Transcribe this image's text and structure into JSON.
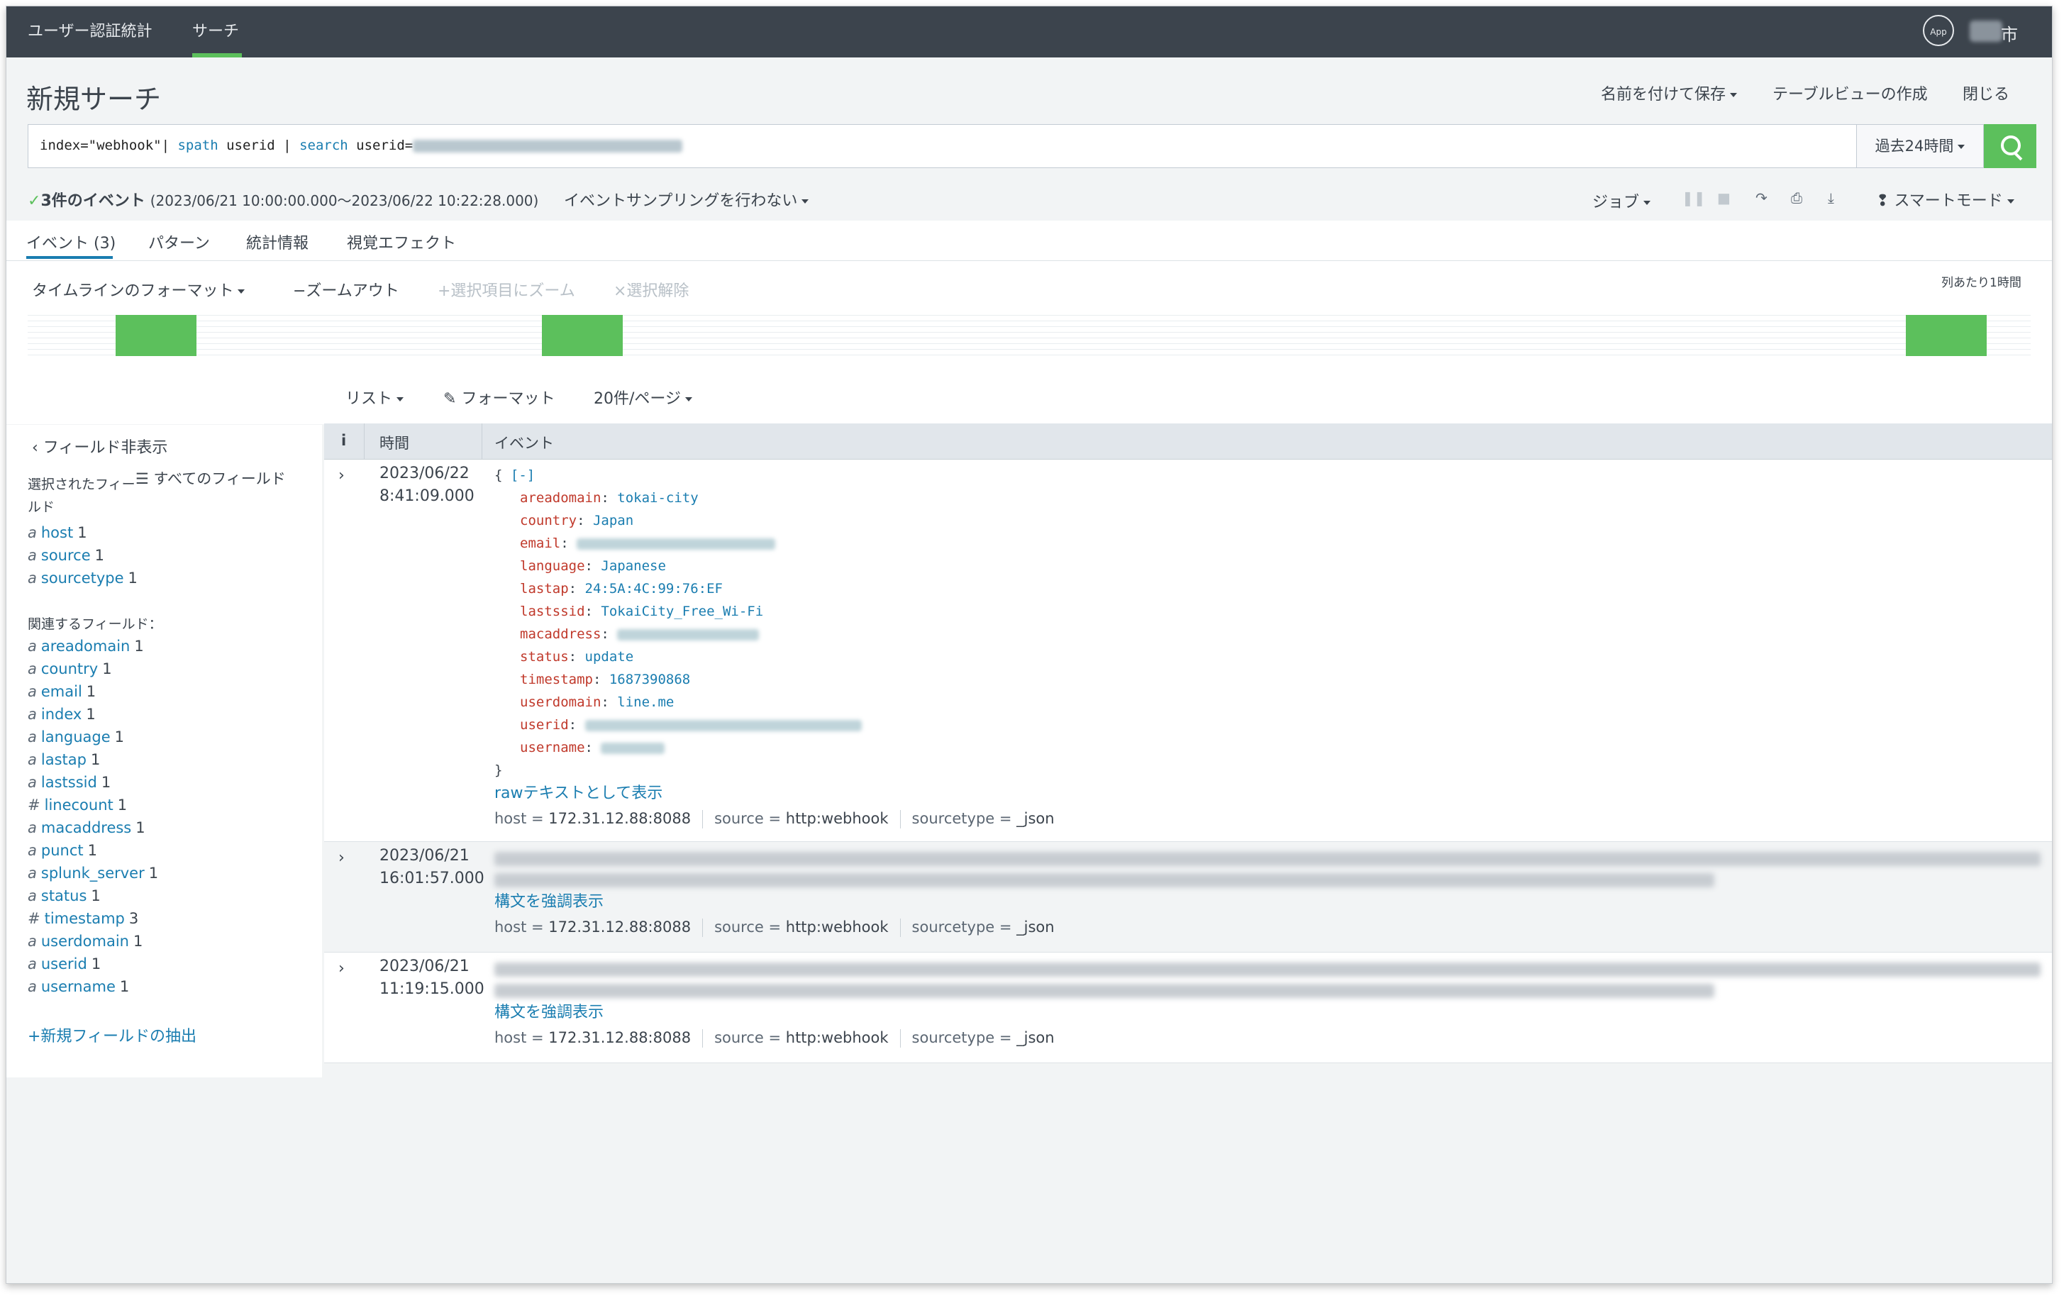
{
  "nav": {
    "app_title": "ユーザー認証統計",
    "search_tab": "サーチ",
    "app_button": "App",
    "user_name_suffix": "市"
  },
  "page": {
    "title": "新規サーチ",
    "save_as": "名前を付けて保存",
    "create_table": "テーブルビューの作成",
    "close": "閉じる"
  },
  "search": {
    "query_p1": "index=\"webhook\"| ",
    "query_kw1": "spath",
    "query_p2": " userid | ",
    "query_kw2": "search",
    "query_p3": " userid=",
    "time_range": "過去24時間"
  },
  "status": {
    "check": "✓",
    "events_count": "3件のイベント",
    "range": "(2023/06/21 10:00:00.000〜2023/06/22 10:22:28.000)",
    "sampling": "イベントサンプリングを行わない",
    "job": "ジョブ",
    "mode": "スマートモード"
  },
  "tabs": {
    "events": "イベント (3)",
    "patterns": "パターン",
    "stats": "統計情報",
    "viz": "視覚エフェクト"
  },
  "timeline": {
    "format": "タイムラインのフォーマット",
    "zoom_out": "−ズームアウト",
    "zoom_sel": "+選択項目にズーム",
    "deselect": "×選択解除",
    "per_col": "列あたり1時間",
    "bars": [
      {
        "hour_index": 2
      },
      {
        "hour_index": 12
      },
      {
        "hour_index": 44
      }
    ]
  },
  "list_controls": {
    "list": "リスト",
    "format": "フォーマット",
    "per_page": "20件/ページ"
  },
  "sidebar": {
    "hide_fields": "フィールド非表示",
    "all_fields": "すべてのフィールド",
    "selected_label": "選択されたフィールド",
    "selected": [
      {
        "type": "a",
        "name": "host",
        "count": "1"
      },
      {
        "type": "a",
        "name": "source",
        "count": "1"
      },
      {
        "type": "a",
        "name": "sourcetype",
        "count": "1"
      }
    ],
    "related_label": "関連するフィールド：",
    "related": [
      {
        "type": "a",
        "name": "areadomain",
        "count": "1"
      },
      {
        "type": "a",
        "name": "country",
        "count": "1"
      },
      {
        "type": "a",
        "name": "email",
        "count": "1"
      },
      {
        "type": "a",
        "name": "index",
        "count": "1"
      },
      {
        "type": "a",
        "name": "language",
        "count": "1"
      },
      {
        "type": "a",
        "name": "lastap",
        "count": "1"
      },
      {
        "type": "a",
        "name": "lastssid",
        "count": "1"
      },
      {
        "type": "#",
        "name": "linecount",
        "count": "1"
      },
      {
        "type": "a",
        "name": "macaddress",
        "count": "1"
      },
      {
        "type": "a",
        "name": "punct",
        "count": "1"
      },
      {
        "type": "a",
        "name": "splunk_server",
        "count": "1"
      },
      {
        "type": "a",
        "name": "status",
        "count": "1"
      },
      {
        "type": "#",
        "name": "timestamp",
        "count": "3"
      },
      {
        "type": "a",
        "name": "userdomain",
        "count": "1"
      },
      {
        "type": "a",
        "name": "userid",
        "count": "1"
      },
      {
        "type": "a",
        "name": "username",
        "count": "1"
      }
    ],
    "extract": "+新規フィールドの抽出"
  },
  "table": {
    "col_info": "i",
    "col_time": "時間",
    "col_event": "イベント"
  },
  "events": [
    {
      "date": "2023/06/22",
      "time": "8:41:09.000",
      "open": "{ ",
      "collapse": "[-]",
      "close": "}",
      "fields": [
        {
          "key": "areadomain",
          "value": "tokai-city"
        },
        {
          "key": "country",
          "value": "Japan"
        },
        {
          "key": "email",
          "value": ""
        },
        {
          "key": "language",
          "value": "Japanese"
        },
        {
          "key": "lastap",
          "value": "24:5A:4C:99:76:EF"
        },
        {
          "key": "lastssid",
          "value": "TokaiCity_Free_Wi-Fi"
        },
        {
          "key": "macaddress",
          "value": ""
        },
        {
          "key": "status",
          "value": "update"
        },
        {
          "key": "timestamp",
          "value": "1687390868"
        },
        {
          "key": "userdomain",
          "value": "line.me"
        },
        {
          "key": "userid",
          "value": ""
        },
        {
          "key": "username",
          "value": ""
        }
      ],
      "raw_link": "rawテキストとして表示",
      "host": "172.31.12.88:8088",
      "source": "http:webhook",
      "sourcetype": "_json"
    },
    {
      "date": "2023/06/21",
      "time": "16:01:57.000",
      "highlight": "構文を強調表示",
      "host": "172.31.12.88:8088",
      "source": "http:webhook",
      "sourcetype": "_json"
    },
    {
      "date": "2023/06/21",
      "time": "11:19:15.000",
      "highlight": "構文を強調表示",
      "host": "172.31.12.88:8088",
      "source": "http:webhook",
      "sourcetype": "_json"
    }
  ],
  "meta_labels": {
    "host": "host = ",
    "source": "source = ",
    "sourcetype": "sourcetype = "
  },
  "colors": {
    "accent_green": "#5cc05c",
    "link_blue": "#1a7db0",
    "topbar": "#3c444d",
    "json_key": "#c0392b"
  }
}
